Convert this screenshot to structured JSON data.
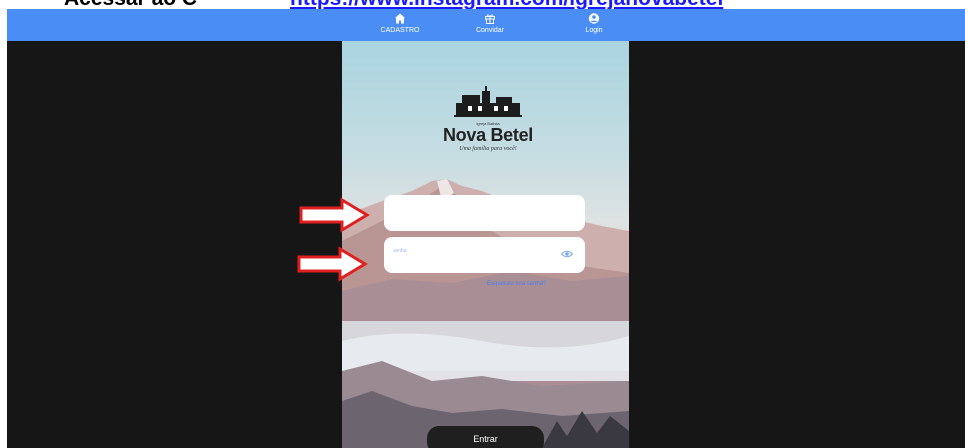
{
  "caption": {
    "left_text": "Acessar ao C",
    "link_text": "https://www.instagram.com/igrejanovabetel"
  },
  "navbar": {
    "items": [
      {
        "label": "CADASTRO",
        "icon": "home-icon"
      },
      {
        "label": "Convidar",
        "icon": "gift-icon"
      },
      {
        "label": "Login",
        "icon": "user-circle-icon"
      }
    ],
    "color": "#4a8ef5"
  },
  "logo": {
    "top_text": "Igreja Batista",
    "name": "Nova Betel",
    "tagline": "Uma família para você!"
  },
  "form": {
    "username_placeholder": "",
    "password_placeholder": "senha",
    "forgot_link": "Esqueceu sua senha?",
    "submit_label": "Entrar"
  },
  "annotations": {
    "arrow_color": "#e02020",
    "arrows": [
      "points-to-username-field",
      "points-to-password-field"
    ]
  }
}
